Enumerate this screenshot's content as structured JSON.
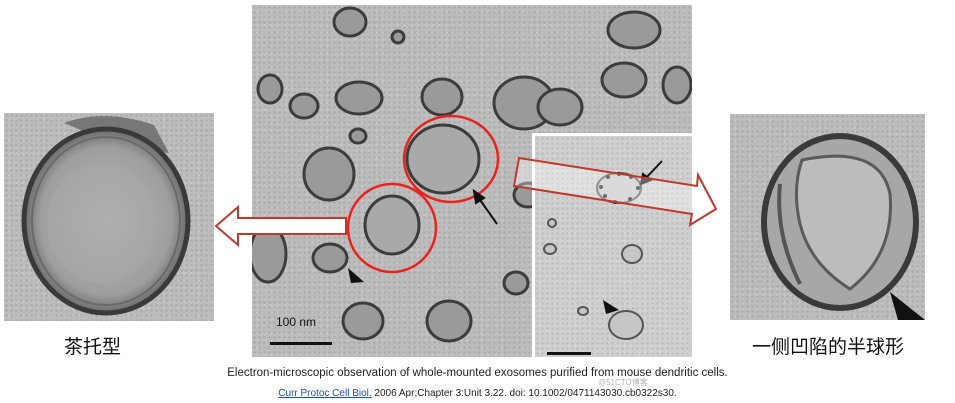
{
  "left_panel": {
    "label": "茶托型"
  },
  "right_panel": {
    "label": "一侧凹陷的半球形"
  },
  "main_image": {
    "scale_label": "100 nm"
  },
  "caption": "Electron-microscopic observation of whole-mounted exosomes purified from mouse dendritic cells.",
  "citation": {
    "link_text": "Curr Protoc Cell Biol.",
    "rest": " 2006 Apr;Chapter 3:Unit 3.22. doi: 10.1002/0471143030.cb0322s30."
  },
  "watermark": "@51CTO博客",
  "colors": {
    "highlight_circle": "#e8231c",
    "arrow_outline": "#c0392b"
  }
}
